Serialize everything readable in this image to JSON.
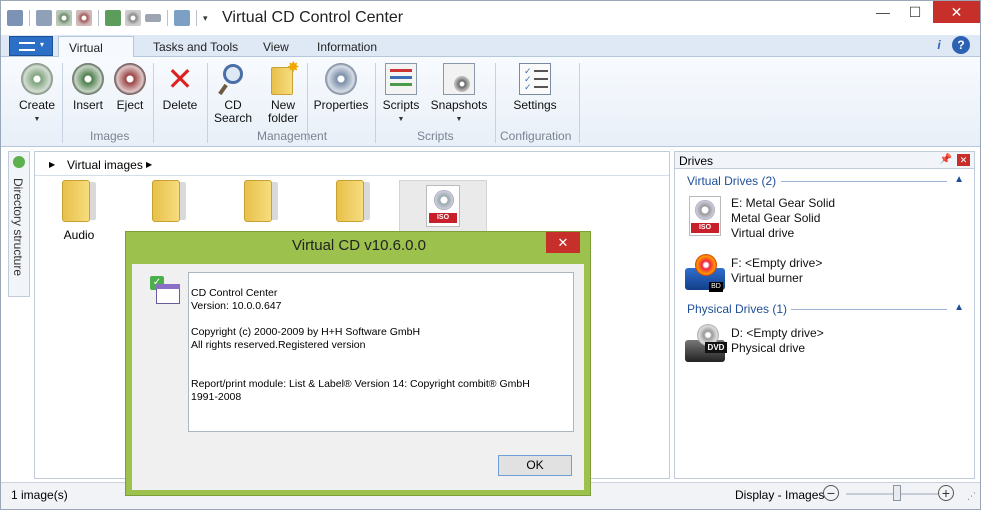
{
  "window": {
    "title": "Virtual CD Control Center",
    "minimize": "—",
    "maximize": "☐",
    "close": "✕"
  },
  "ribbon": {
    "tabs": [
      "Virtual CD",
      "Tasks and Tools",
      "View",
      "Information"
    ],
    "buttons": {
      "create": "Create",
      "insert": "Insert",
      "eject": "Eject",
      "delete": "Delete",
      "cd_search_1": "CD",
      "cd_search_2": "Search",
      "new_folder_1": "New",
      "new_folder_2": "folder",
      "properties": "Properties",
      "scripts": "Scripts",
      "snapshots": "Snapshots",
      "settings": "Settings"
    },
    "groups": {
      "images": "Images",
      "management": "Management",
      "scripts": "Scripts",
      "configuration": "Configuration"
    }
  },
  "left_pane": {
    "label": "Directory structure"
  },
  "main": {
    "breadcrumb": "Virtual images",
    "items": [
      {
        "label": "Audio"
      }
    ]
  },
  "drives": {
    "title": "Drives",
    "virtual_header": "Virtual Drives (2)",
    "physical_header": "Physical Drives (1)",
    "virtual": [
      {
        "line1": "E: Metal Gear Solid",
        "line2": "Metal Gear Solid",
        "line3": "Virtual drive",
        "badge": "ISO"
      },
      {
        "line1": "F: <Empty drive>",
        "line2": "Virtual burner",
        "badge": "BD"
      }
    ],
    "physical": [
      {
        "line1": "D: <Empty drive>",
        "line2": "Physical drive",
        "badge": "DVD"
      }
    ]
  },
  "status": {
    "left": "1 image(s)",
    "zoom_label": "Display - Images",
    "zoom_minus": "−",
    "zoom_plus": "+"
  },
  "dialog": {
    "title": "Virtual CD v10.6.0.0",
    "close": "✕",
    "lines": {
      "l1": "CD Control Center",
      "l2": "Version: 10.0.0.647",
      "l3": "Copyright (c) 2000-2009 by H+H Software GmbH",
      "l4": "All rights reserved.Registered version",
      "l5": "Report/print module: List & Label® Version 14: Copyright combit® GmbH",
      "l6": "1991-2008"
    },
    "ok": "OK"
  },
  "colors": {
    "accent": "#2b6fc6",
    "dialog_frame": "#9cc14d",
    "close_red": "#c7302a",
    "section_blue": "#1e4e9a"
  }
}
